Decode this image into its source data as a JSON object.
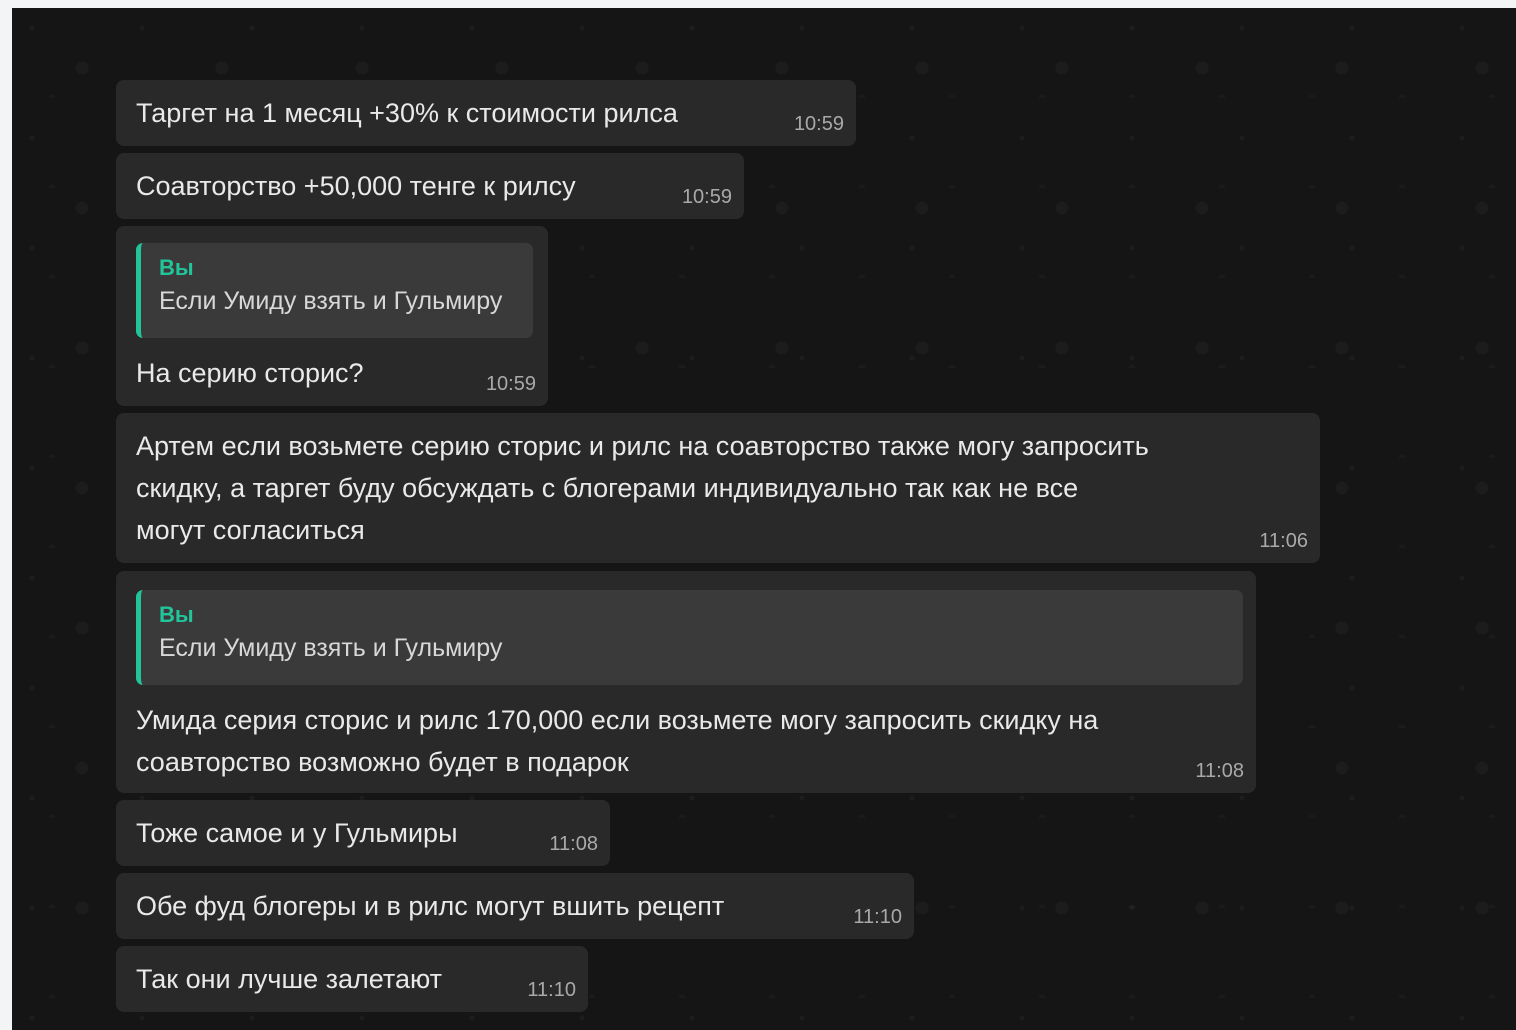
{
  "messages": [
    {
      "text": "Таргет на 1 месяц +30% к стоимости рилса",
      "time": "10:59"
    },
    {
      "text": "Соавторство +50,000 тенге к рилсу",
      "time": "10:59"
    },
    {
      "reply": {
        "author": "Вы",
        "text": "Если Умиду взять и Гульмиру"
      },
      "text": "На серию сторис?",
      "time": "10:59"
    },
    {
      "text": "Артем если возьмете серию сторис и рилс на соавторство также могу запросить\nскидку, а таргет буду обсуждать с блогерами индивидуально так как не все\nмогут согласиться",
      "time": "11:06"
    },
    {
      "reply": {
        "author": "Вы",
        "text": "Если Умиду взять и Гульмиру"
      },
      "text": "Умида серия сторис и рилс 170,000 если возьмете могу запросить скидку на\nсоавторство возможно будет в подарок",
      "time": "11:08"
    },
    {
      "text": "Тоже самое и у Гульмиры",
      "time": "11:08"
    },
    {
      "text": "Обе фуд блогеры и в рилс могут вшить рецепт",
      "time": "11:10"
    },
    {
      "text": "Так они лучше залетают",
      "time": "11:10"
    }
  ]
}
